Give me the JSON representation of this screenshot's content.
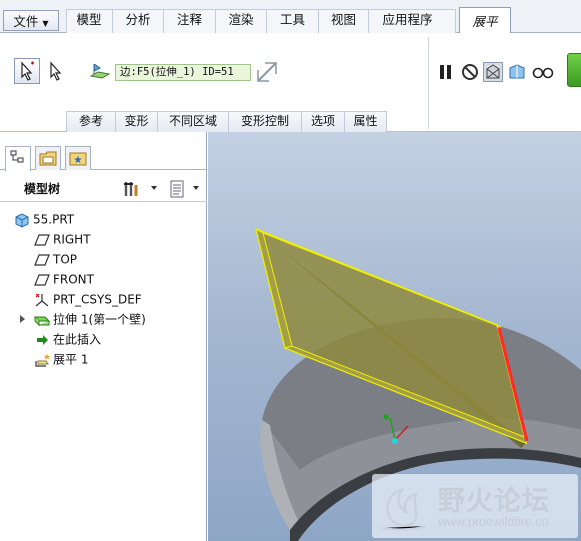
{
  "menu": {
    "file_label": "文件",
    "tabs": [
      {
        "label": "模型"
      },
      {
        "label": "分析"
      },
      {
        "label": "注释"
      },
      {
        "label": "渲染"
      },
      {
        "label": "工具"
      },
      {
        "label": "视图"
      },
      {
        "label": "应用程序"
      }
    ],
    "active_tab": "展平"
  },
  "ribbon": {
    "edge_reference": "边:F5(拉伸_1) ID=51",
    "subtabs": [
      "参考",
      "变形",
      "不同区域",
      "变形控制",
      "选项",
      "属性"
    ]
  },
  "model_tree": {
    "title": "模型树",
    "items": [
      {
        "label": "55.PRT",
        "icon": "part-icon"
      },
      {
        "label": "RIGHT",
        "icon": "datum-plane-icon"
      },
      {
        "label": "TOP",
        "icon": "datum-plane-icon"
      },
      {
        "label": "FRONT",
        "icon": "datum-plane-icon"
      },
      {
        "label": "PRT_CSYS_DEF",
        "icon": "csys-icon"
      },
      {
        "label": "拉伸 1(第一个壁)",
        "icon": "extrude-wall-icon"
      },
      {
        "label": "在此插入",
        "icon": "insert-here-arrow-icon"
      },
      {
        "label": "展平 1",
        "icon": "flatten-icon"
      }
    ]
  },
  "watermark": {
    "title": "野火论坛",
    "url": "www.proewildfire.cn"
  },
  "colors": {
    "accent": "#3b9b20",
    "edge_field_bg": "#eaf6dc",
    "selection_edge": "#ff2a2a",
    "flat_plate": "#8f8a3e",
    "highlight": "#f0f000"
  }
}
